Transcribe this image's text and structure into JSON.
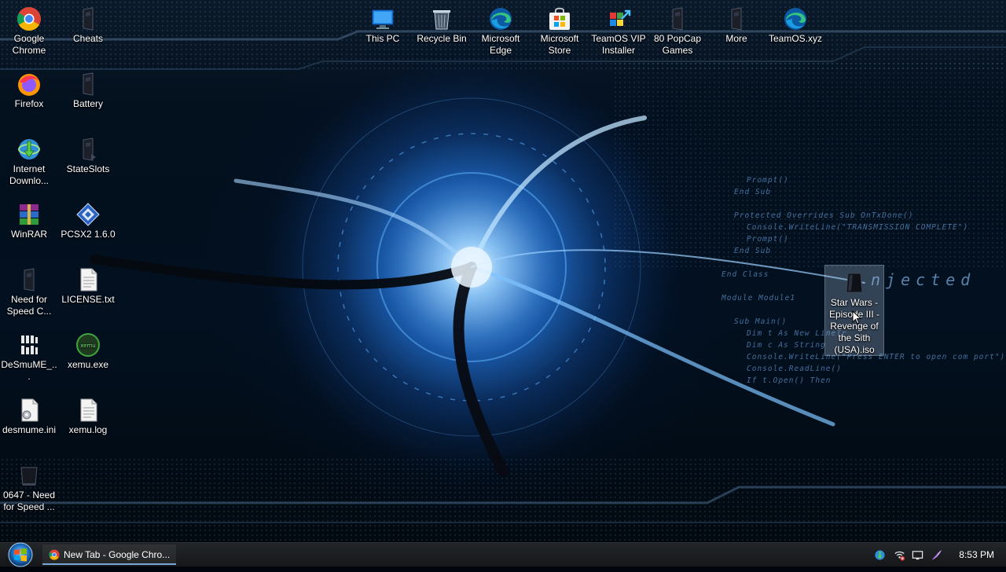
{
  "desktop": {
    "icons": [
      {
        "label": "Google Chrome",
        "icon": "chrome-icon"
      },
      {
        "label": "Cheats",
        "icon": "generic-app-icon"
      },
      {
        "label": "Firefox",
        "icon": "firefox-icon"
      },
      {
        "label": "Battery",
        "icon": "generic-app-icon"
      },
      {
        "label": "Internet Downlo...",
        "icon": "idm-icon"
      },
      {
        "label": "StateSlots",
        "icon": "generic-app-icon"
      },
      {
        "label": "WinRAR",
        "icon": "winrar-icon"
      },
      {
        "label": "PCSX2 1.6.0",
        "icon": "pcsx2-icon"
      },
      {
        "label": "Need for Speed C...",
        "icon": "generic-app-icon"
      },
      {
        "label": "LICENSE.txt",
        "icon": "text-file-icon"
      },
      {
        "label": "DeSmuME_...",
        "icon": "desmume-icon"
      },
      {
        "label": "xemu.exe",
        "icon": "xemu-icon"
      },
      {
        "label": "desmume.ini",
        "icon": "ini-file-icon"
      },
      {
        "label": "xemu.log",
        "icon": "text-file-icon"
      },
      {
        "label": "0647 - Need for Speed ...",
        "icon": "generic-app-icon"
      },
      {
        "label": "This PC",
        "icon": "this-pc-icon"
      },
      {
        "label": "Recycle Bin",
        "icon": "recycle-bin-icon"
      },
      {
        "label": "Microsoft Edge",
        "icon": "edge-icon"
      },
      {
        "label": "Microsoft Store",
        "icon": "store-icon"
      },
      {
        "label": "TeamOS VIP Installer",
        "icon": "installer-icon"
      },
      {
        "label": "80 PopCap Games",
        "icon": "generic-app-icon"
      },
      {
        "label": "More",
        "icon": "generic-app-icon"
      },
      {
        "label": "TeamOS.xyz",
        "icon": "edge-icon"
      },
      {
        "label": "Star Wars - Episode III - Revenge of the Sith (USA).iso",
        "icon": "iso-file-icon"
      }
    ],
    "wallpaper_code": [
      "Prompt()",
      "End Sub",
      "Protected Overrides Sub OnTxDone()",
      "Console.WriteLine(\"TRANSMISSION COMPLETE\")",
      "Prompt()",
      "End Sub",
      "End Class",
      "Module Module1",
      "Sub Main()",
      "Dim t As New LineTr",
      "Dim c As String",
      "Console.WriteLine(\"Press ENTER to open com port\")",
      "Console.ReadLine()",
      "If t.Open() Then"
    ],
    "wallpaper_word": "njected"
  },
  "taskbar": {
    "start_label": "Start",
    "open_app": "New Tab - Google Chro...",
    "clock": "8:53 PM"
  }
}
